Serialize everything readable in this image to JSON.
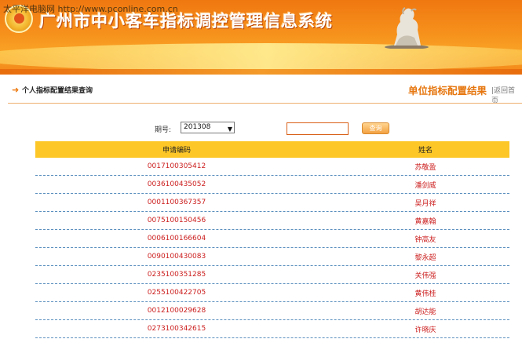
{
  "header": {
    "watermark": "太平洋电脑网 http://www.pconline.com.cn",
    "system_title": "广州市中小客车指标调控管理信息系统"
  },
  "breadcrumb": {
    "text": "个人指标配置结果查询",
    "result_title": "单位指标配置结果",
    "return_link": "|返回首页"
  },
  "query": {
    "period_label": "期号:",
    "period_value": "201308",
    "input_value": "",
    "button_label": "查询"
  },
  "table": {
    "columns": [
      "申请编码",
      "姓名"
    ],
    "rows": [
      {
        "code": "0017100305412",
        "name": "苏敬盈"
      },
      {
        "code": "0036100435052",
        "name": "潘剑威"
      },
      {
        "code": "0001100367357",
        "name": "吴月祥"
      },
      {
        "code": "0075100150456",
        "name": "黄嘉翰"
      },
      {
        "code": "0006100166604",
        "name": "钟高友"
      },
      {
        "code": "0090100430083",
        "name": "黎永超"
      },
      {
        "code": "0235100351285",
        "name": "关伟强"
      },
      {
        "code": "0255100422705",
        "name": "黄伟桂"
      },
      {
        "code": "0012100029628",
        "name": "胡达能"
      },
      {
        "code": "0273100342615",
        "name": "许晓庆"
      }
    ]
  },
  "colors": {
    "banner": "#f6911c",
    "accent": "#e67710",
    "table_header": "#fdc727",
    "row_text": "#cc1d1d",
    "row_divider": "#5a8fbe"
  }
}
